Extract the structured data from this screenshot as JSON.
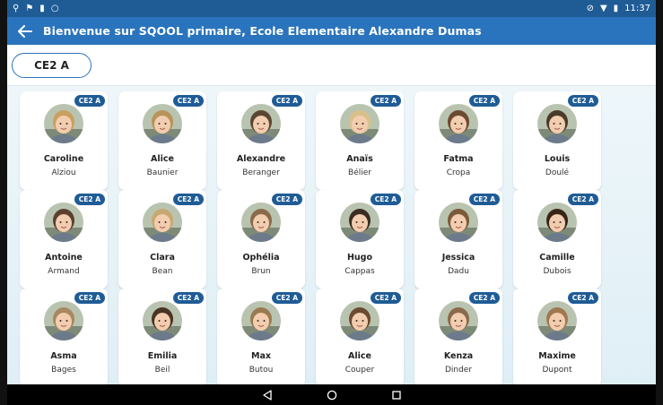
{
  "status_bar": {
    "left_icons": [
      "usb-icon",
      "location-icon",
      "battery-saver-icon",
      "circle-notification-icon"
    ],
    "right_icons": [
      "do-not-disturb-icon",
      "wifi-icon",
      "battery-icon"
    ],
    "time": "11:37"
  },
  "app_bar": {
    "title": "Bienvenue sur SQOOL primaire, Ecole Elementaire Alexandre Dumas"
  },
  "class_selector": {
    "label": "CE2 A"
  },
  "students": [
    {
      "first_name": "Caroline",
      "last_name": "Alziou",
      "badge": "CE2 A",
      "hair": "#c9a060"
    },
    {
      "first_name": "Alice",
      "last_name": "Baunier",
      "badge": "CE2 A",
      "hair": "#b8935a"
    },
    {
      "first_name": "Alexandre",
      "last_name": "Beranger",
      "badge": "CE2 A",
      "hair": "#5a4632"
    },
    {
      "first_name": "Anaïs",
      "last_name": "Bélier",
      "badge": "CE2 A",
      "hair": "#d9c08a"
    },
    {
      "first_name": "Fatma",
      "last_name": "Cropa",
      "badge": "CE2 A",
      "hair": "#6b4a30"
    },
    {
      "first_name": "Louis",
      "last_name": "Doulé",
      "badge": "CE2 A",
      "hair": "#4a3a2a"
    },
    {
      "first_name": "Antoine",
      "last_name": "Armand",
      "badge": "CE2 A",
      "hair": "#5b4030"
    },
    {
      "first_name": "Clara",
      "last_name": "Bean",
      "badge": "CE2 A",
      "hair": "#c8a872"
    },
    {
      "first_name": "Ophélia",
      "last_name": "Brun",
      "badge": "CE2 A",
      "hair": "#8a6a48"
    },
    {
      "first_name": "Hugo",
      "last_name": "Cappas",
      "badge": "CE2 A",
      "hair": "#3a2e24"
    },
    {
      "first_name": "Jessica",
      "last_name": "Dadu",
      "badge": "CE2 A",
      "hair": "#7a5a3a"
    },
    {
      "first_name": "Camille",
      "last_name": "Dubois",
      "badge": "CE2 A",
      "hair": "#3a2418"
    },
    {
      "first_name": "Asma",
      "last_name": "Bages",
      "badge": "CE2 A",
      "hair": "#a88860"
    },
    {
      "first_name": "Emilia",
      "last_name": "Beil",
      "badge": "CE2 A",
      "hair": "#4a3424"
    },
    {
      "first_name": "Max",
      "last_name": "Butou",
      "badge": "CE2 A",
      "hair": "#9a7a50"
    },
    {
      "first_name": "Alice",
      "last_name": "Couper",
      "badge": "CE2 A",
      "hair": "#6a4a30"
    },
    {
      "first_name": "Kenza",
      "last_name": "Dinder",
      "badge": "CE2 A",
      "hair": "#8a6a4a"
    },
    {
      "first_name": "Maxime",
      "last_name": "Dupont",
      "badge": "CE2 A",
      "hair": "#a07850"
    }
  ],
  "nav_bar": {
    "buttons": [
      "back-icon",
      "home-icon",
      "recents-icon"
    ]
  },
  "colors": {
    "primary": "#2a74bd",
    "status_bar": "#1f5c96",
    "badge": "#1f5c96"
  }
}
